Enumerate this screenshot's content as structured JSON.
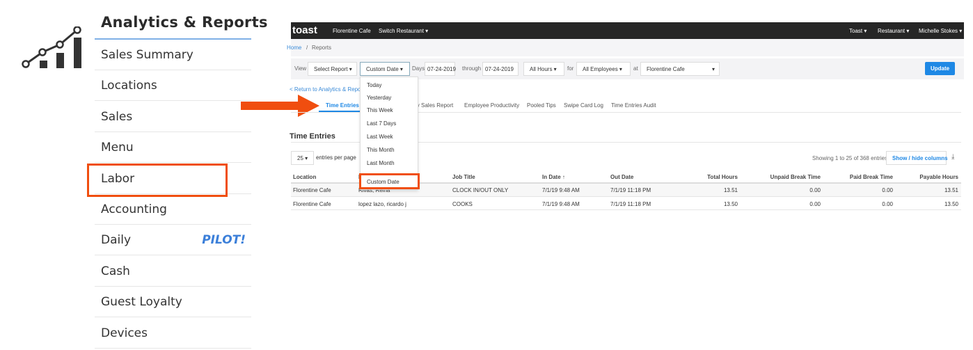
{
  "left_menu": {
    "title": "Analytics & Reports",
    "icon": "analytics-chart-icon",
    "items": [
      {
        "label": "Sales Summary"
      },
      {
        "label": "Locations"
      },
      {
        "label": "Sales"
      },
      {
        "label": "Menu"
      },
      {
        "label": "Labor",
        "highlighted": true
      },
      {
        "label": "Accounting"
      },
      {
        "label": "Daily",
        "badge": "PILOT!"
      },
      {
        "label": "Cash"
      },
      {
        "label": "Guest Loyalty"
      },
      {
        "label": "Devices"
      }
    ],
    "highlight_color": "#f04e0f",
    "badge_color": "#3b7fd9"
  },
  "topbar": {
    "logo": "toast",
    "restaurant": "Florentine Cafe",
    "switch": "Switch Restaurant ▾",
    "toast_menu": "Toast ▾",
    "restaurant_menu": "Restaurant ▾",
    "user": "Michelle Stokes ▾"
  },
  "breadcrumb": {
    "home": "Home",
    "sep": "/",
    "current": "Reports"
  },
  "filters": {
    "view_label": "View",
    "report": "Select Report ▾",
    "date_range": "Custom Date ▾",
    "days_label": "Days",
    "from": "07-24-2019",
    "through_label": "through",
    "to": "07-24-2019",
    "hours": "All Hours ▾",
    "for_label": "for",
    "employees": "All Employees ▾",
    "at_label": "at",
    "location": "Florentine Cafe",
    "location_caret": "▾",
    "update": "Update"
  },
  "date_dropdown": {
    "options": [
      "Today",
      "Yesterday",
      "This Week",
      "Last 7 Days",
      "Last Week",
      "This Month",
      "Last Month",
      "Custom Date"
    ]
  },
  "return_link": "< Return to Analytics & Reports",
  "tabs": [
    "Time Entries",
    "Daily Sales Report",
    "Employee Productivity",
    "Pooled Tips",
    "Swipe Card Log",
    "Time Entries Audit"
  ],
  "section_title": "Time Entries",
  "page_size": {
    "value": "25 ▾",
    "label": "entries per page"
  },
  "showing": "Showing 1 to 25 of 368 entries",
  "show_hide": "Show / hide columns",
  "table": {
    "columns": [
      "Location",
      "Employee",
      "Job Title",
      "In Date ↑",
      "Out Date",
      "Total Hours",
      "Unpaid Break Time",
      "Paid Break Time",
      "Payable Hours"
    ],
    "rows": [
      [
        "Florentine Cafe",
        "Rivas, Reina",
        "CLOCK IN/OUT ONLY",
        "7/1/19 9:48 AM",
        "7/1/19 11:18 PM",
        "13.51",
        "0.00",
        "0.00",
        "13.51"
      ],
      [
        "Florentine Cafe",
        "lopez lazo, ricardo j",
        "COOKS",
        "7/1/19 9:48 AM",
        "7/1/19 11:18 PM",
        "13.50",
        "0.00",
        "0.00",
        "13.50"
      ]
    ]
  },
  "accent": "#1e88e5"
}
